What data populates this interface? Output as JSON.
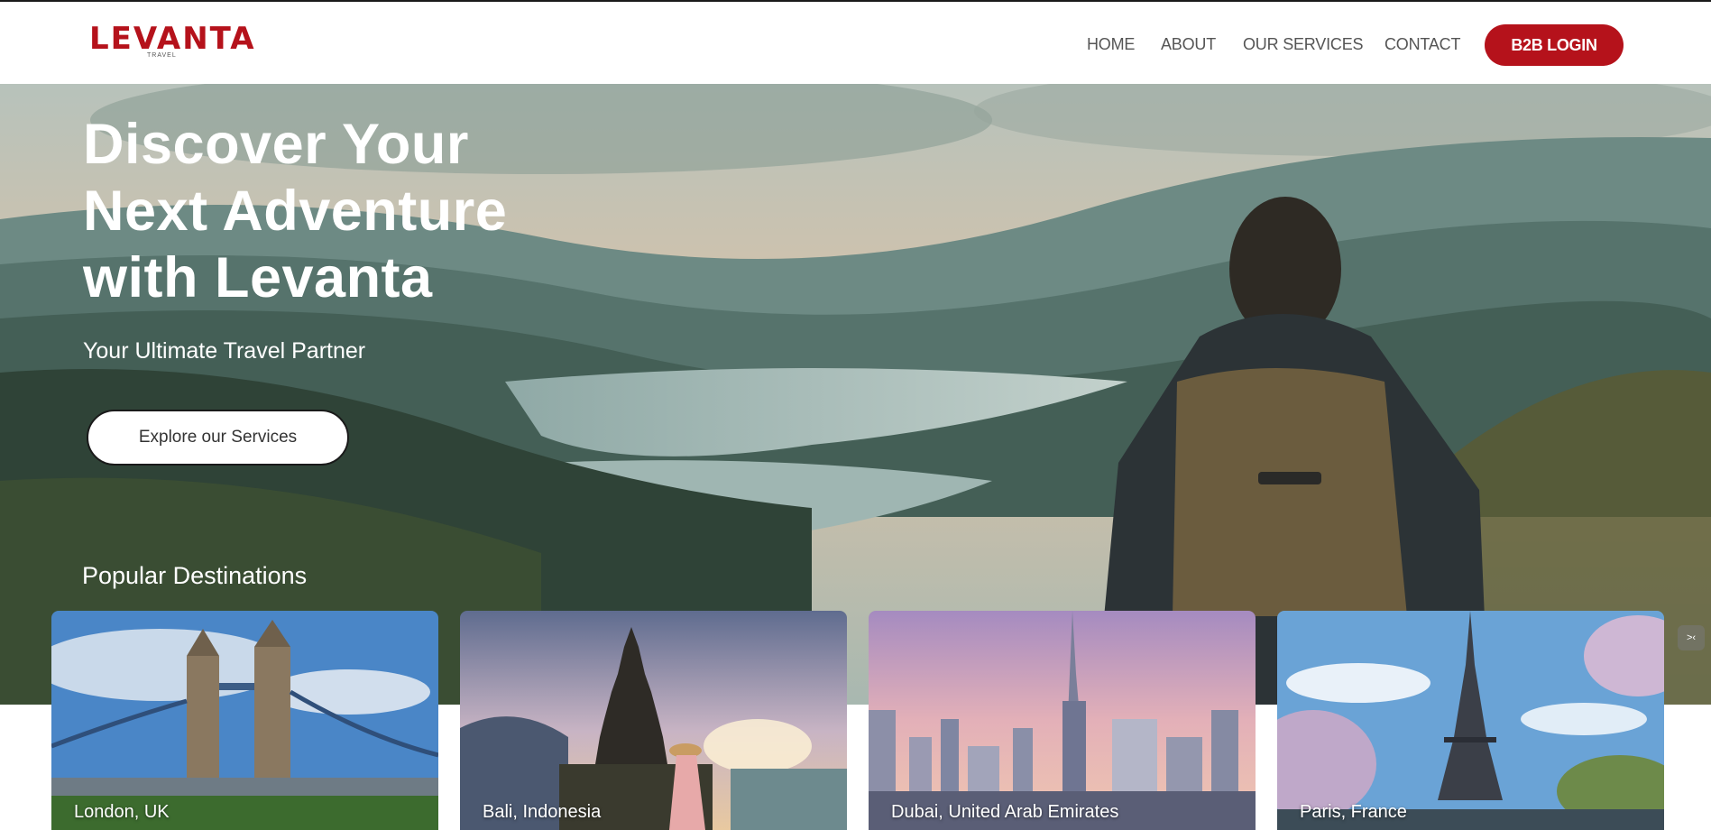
{
  "brand": {
    "name": "LEVANTA",
    "tagline": "TRAVEL",
    "accent_color": "#b5121b"
  },
  "nav": {
    "items": [
      "HOME",
      "ABOUT",
      "OUR SERVICES",
      "CONTACT"
    ],
    "login_label": "B2B LOGIN"
  },
  "hero": {
    "title_lines": [
      "Discover Your",
      "Next Adventure",
      "with Levanta"
    ],
    "subtitle": "Your Ultimate Travel Partner",
    "cta_label": "Explore our Services",
    "image_icon": "backpacker-mountain-lake-photo"
  },
  "destinations": {
    "heading": "Popular Destinations",
    "items": [
      {
        "name": "London, UK",
        "image_icon": "tower-bridge-photo"
      },
      {
        "name": "Bali, Indonesia",
        "image_icon": "bali-temple-photo"
      },
      {
        "name": "Dubai, United Arab Emirates",
        "image_icon": "dubai-skyline-photo"
      },
      {
        "name": "Paris, France",
        "image_icon": "eiffel-tower-photo"
      }
    ]
  },
  "widgets": {
    "collapse_icon": "collapse-arrows-icon",
    "collapse_glyph": ">‹"
  }
}
